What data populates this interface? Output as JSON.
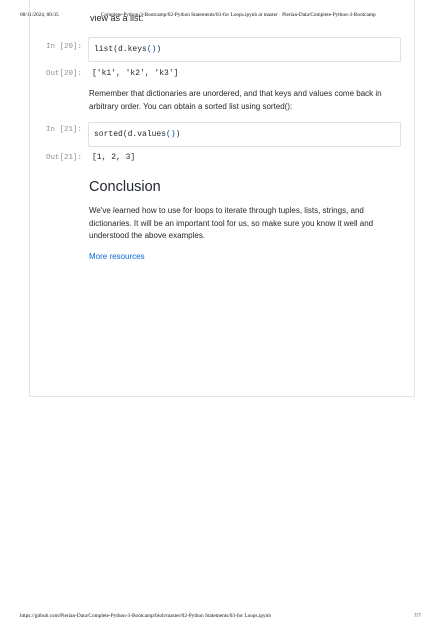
{
  "print_header": {
    "date": "08/11/2024, 00:35",
    "title": "Complete-Python-3-Bootcamp/02-Python Statements/03-for Loops.ipynb at master · Pierian-Data/Complete-Python-3-Bootcamp"
  },
  "print_footer": {
    "url": "https://github.com/Pierian-Data/Complete-Python-3-Bootcamp/blob/master/02-Python Statements/03-for Loops.ipynb",
    "page": "7/7"
  },
  "notebook": {
    "clipped_text": "view as a list:",
    "cells": [
      {
        "in_prompt": "In [20]:",
        "code_fn": "list",
        "code_mid": "(d.keys",
        "code_parens": "()",
        "code_end": ")",
        "out_prompt": "Out[20]:",
        "output": "['k1', 'k2', 'k3']"
      },
      {
        "in_prompt": "In [21]:",
        "code_fn": "sorted",
        "code_mid": "(d.values",
        "code_parens": "()",
        "code_end": ")",
        "out_prompt": "Out[21]:",
        "output": "[1, 2, 3]"
      }
    ],
    "markdown_1": "Remember that dictionaries are unordered, and that keys and values come back in arbitrary order. You can obtain a sorted list using sorted():",
    "conclusion_heading": "Conclusion",
    "conclusion_text": "We've learned how to use for loops to iterate through tuples, lists, strings, and dictionaries. It will be an important tool for us, so make sure you know it well and understood the above examples.",
    "more_resources_link": "More resources"
  }
}
